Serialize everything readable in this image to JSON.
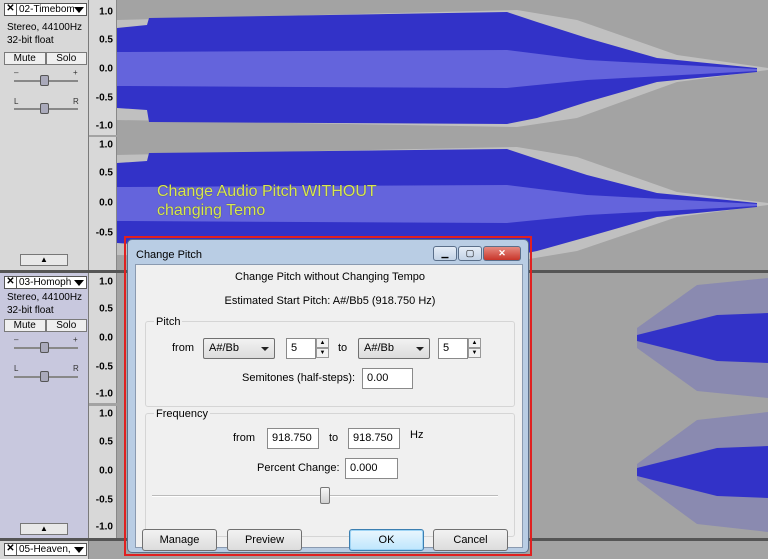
{
  "tracks": [
    {
      "name": "02-Timebom",
      "info1": "Stereo, 44100Hz",
      "info2": "32-bit float",
      "mute": "Mute",
      "solo": "Solo"
    },
    {
      "name": "03-Homoph",
      "info1": "Stereo, 44100Hz",
      "info2": "32-bit float",
      "mute": "Mute",
      "solo": "Solo"
    },
    {
      "name": "05-Heaven,"
    }
  ],
  "slider_labels": {
    "minus": "–",
    "plus": "+",
    "left": "L",
    "right": "R"
  },
  "ruler_ticks": [
    "1.0",
    "0.5",
    "0.0",
    "-0.5",
    "-1.0"
  ],
  "overlay_text": {
    "line1": "Change Audio Pitch WITHOUT",
    "line2": "changing Temo"
  },
  "dialog": {
    "title": "Change Pitch",
    "heading": "Change Pitch without Changing Tempo",
    "estimate": "Estimated Start Pitch: A#/Bb5 (918.750 Hz)",
    "pitch": {
      "group": "Pitch",
      "from_label": "from",
      "from_note": "A#/Bb",
      "from_octave": "5",
      "to_label": "to",
      "to_note": "A#/Bb",
      "to_octave": "5",
      "semitones_label": "Semitones (half-steps):",
      "semitones": "0.00"
    },
    "frequency": {
      "group": "Frequency",
      "from_label": "from",
      "from_value": "918.750",
      "to_label": "to",
      "to_value": "918.750",
      "unit": "Hz",
      "percent_label": "Percent Change:",
      "percent": "0.000",
      "slider_position": 0.5
    },
    "buttons": {
      "manage": "Manage",
      "preview": "Preview",
      "ok": "OK",
      "cancel": "Cancel"
    }
  },
  "colors": {
    "waveform": "#3232c8",
    "waveform_rms": "#6464dc",
    "clip_bg": "#c0c0c0",
    "red_box": "#e02020",
    "overlay_text": "#d8e850"
  }
}
